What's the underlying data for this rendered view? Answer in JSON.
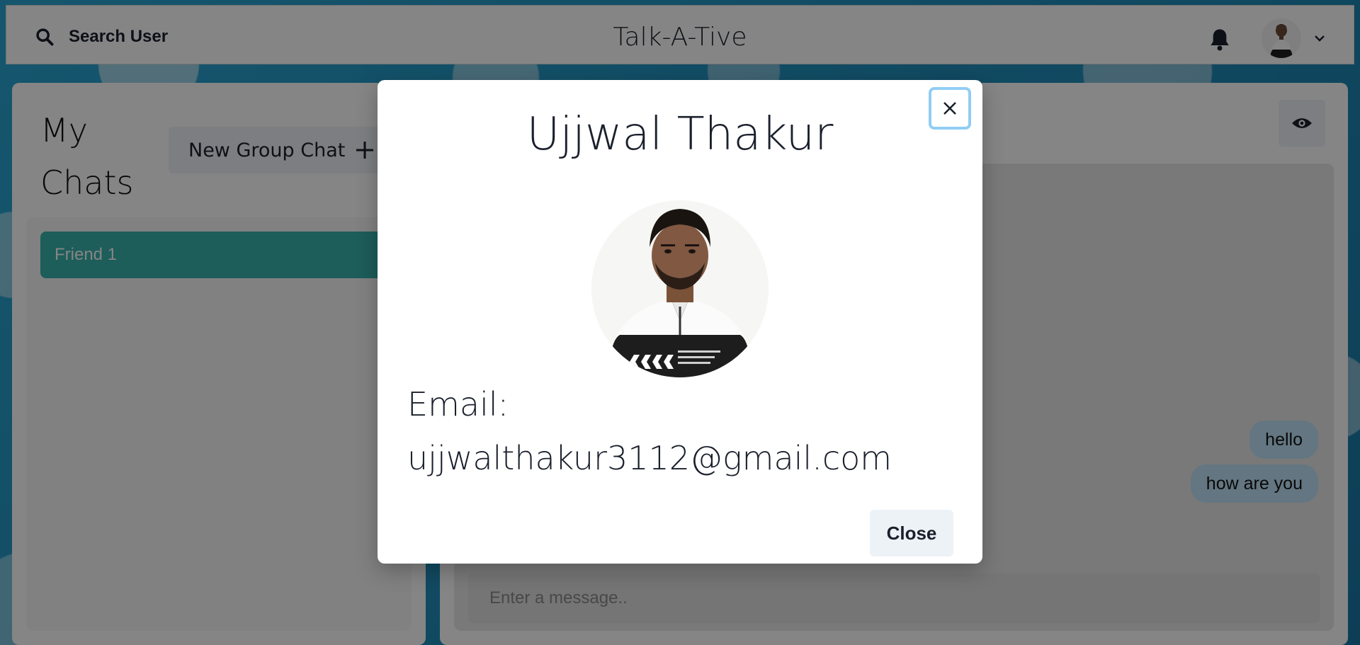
{
  "header": {
    "search_label": "Search User",
    "app_title": "Talk-A-Tive"
  },
  "sidebar": {
    "title": "My Chats",
    "new_group_label": "New Group Chat",
    "chats": [
      {
        "name": "Friend 1"
      }
    ]
  },
  "chat": {
    "messages": [
      {
        "text": "hello"
      },
      {
        "text": "how are you"
      }
    ],
    "input_placeholder": "Enter a message.."
  },
  "modal": {
    "title": "Ujjwal Thakur",
    "email_label": "Email:",
    "email": "ujjwalthakur3112@gmail.com",
    "close_label": "Close"
  },
  "colors": {
    "accent_teal": "#38b2ac",
    "bubble_blue": "#bee3f8",
    "focus_ring": "#90cdf4"
  }
}
